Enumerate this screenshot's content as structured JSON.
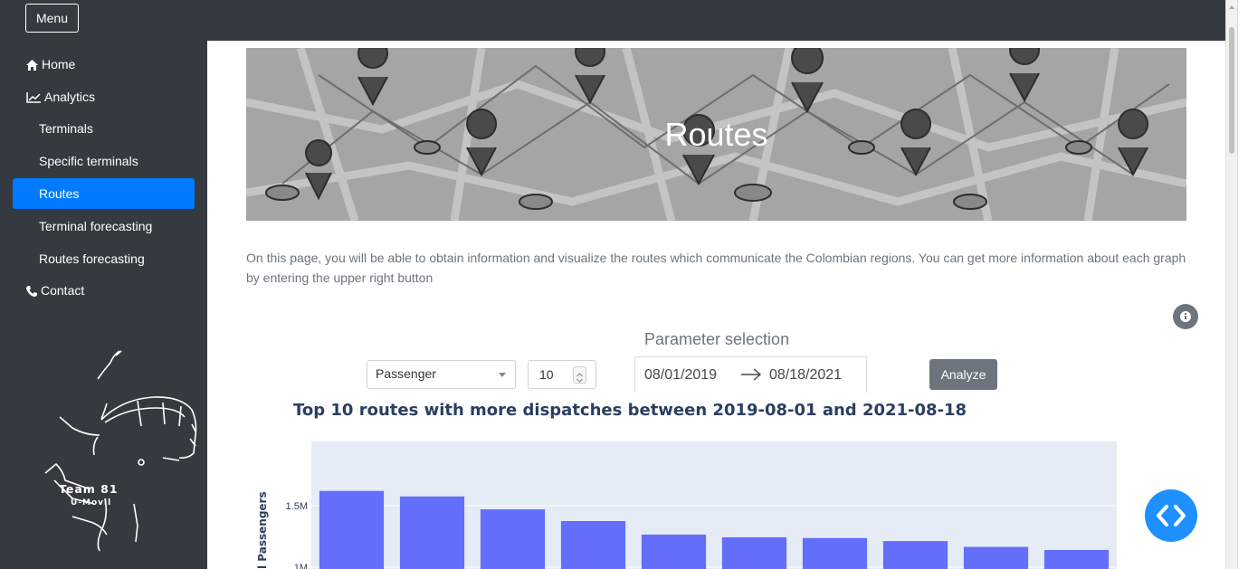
{
  "topbar": {
    "menu_label": "Menu"
  },
  "sidebar": {
    "items": [
      {
        "label": "Home",
        "icon": "home-icon"
      },
      {
        "label": "Analytics",
        "icon": "line-chart-icon"
      },
      {
        "label": "Terminals"
      },
      {
        "label": "Specific terminals"
      },
      {
        "label": "Routes",
        "active": true
      },
      {
        "label": "Terminal forecasting"
      },
      {
        "label": "Routes forecasting"
      },
      {
        "label": "Contact",
        "icon": "phone-icon"
      }
    ],
    "logo": {
      "line1": "Team 81",
      "line2": "U-Movil"
    }
  },
  "banner": {
    "title": "Routes"
  },
  "intro": "On this page, you will be able to obtain information and visualize the routes which communicate the Colombian regions. You can get more information about each graph by entering the upper right button",
  "params": {
    "title": "Parameter selection",
    "type_value": "Passenger",
    "number_value": "10",
    "date_start": "08/01/2019",
    "date_end": "08/18/2021",
    "analyze_label": "Analyze"
  },
  "colors": {
    "sidebar_bg": "#343a40",
    "active": "#007bff",
    "bar": "#636efa",
    "plot_bg": "#e5ecf6",
    "fab": "#1e90ff"
  },
  "chart_data": {
    "type": "bar",
    "title": "Top 10 routes with more dispatches between 2019-08-01 and 2021-08-18",
    "ylabel": "l Passengers",
    "yticks": [
      "1.5M",
      "1M"
    ],
    "ytick_values": [
      1500000,
      1000000
    ],
    "ylim_visible": [
      0,
      1720000
    ],
    "categories": [],
    "values": [
      1620000,
      1575000,
      1470000,
      1375000,
      1265000,
      1243000,
      1237000,
      1212000,
      1165000,
      1140000
    ]
  }
}
